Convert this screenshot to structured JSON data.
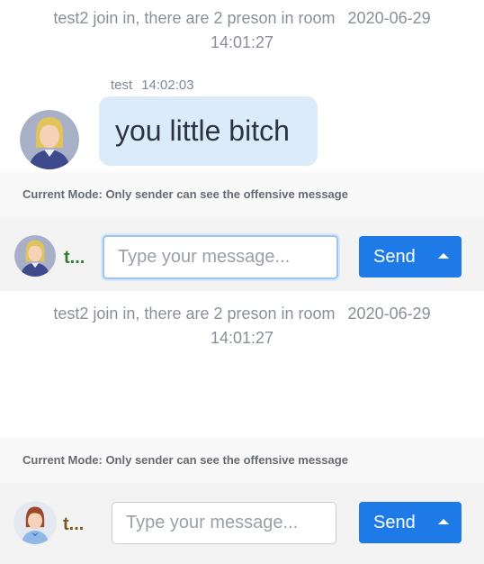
{
  "panel_a": {
    "system_message": {
      "text": "test2 join in, there are 2 preson in room",
      "date": "2020-06-29",
      "time": "14:01:27"
    },
    "chat_message": {
      "sender": "test",
      "time": "14:02:03",
      "text": "you little bitch"
    },
    "mode_text": "Current Mode: Only sender can see the offensive message",
    "input": {
      "user_label": "t...",
      "placeholder": "Type your message...",
      "send_label": "Send"
    }
  },
  "panel_b": {
    "system_message": {
      "text": "test2 join in, there are 2 preson in room",
      "date": "2020-06-29",
      "time": "14:01:27"
    },
    "mode_text": "Current Mode: Only sender can see the offensive message",
    "input": {
      "user_label": "t...",
      "placeholder": "Type your message...",
      "send_label": "Send"
    }
  },
  "colors": {
    "accent": "#1e7ae6",
    "bubble": "#dcebf9",
    "user_a_name": "#2e7d32",
    "user_b_name": "#7a5a20"
  },
  "icons": {
    "avatar_a": "blonde-woman-avatar",
    "avatar_b": "brown-hair-woman-avatar",
    "send_caret": "caret-up-icon"
  }
}
